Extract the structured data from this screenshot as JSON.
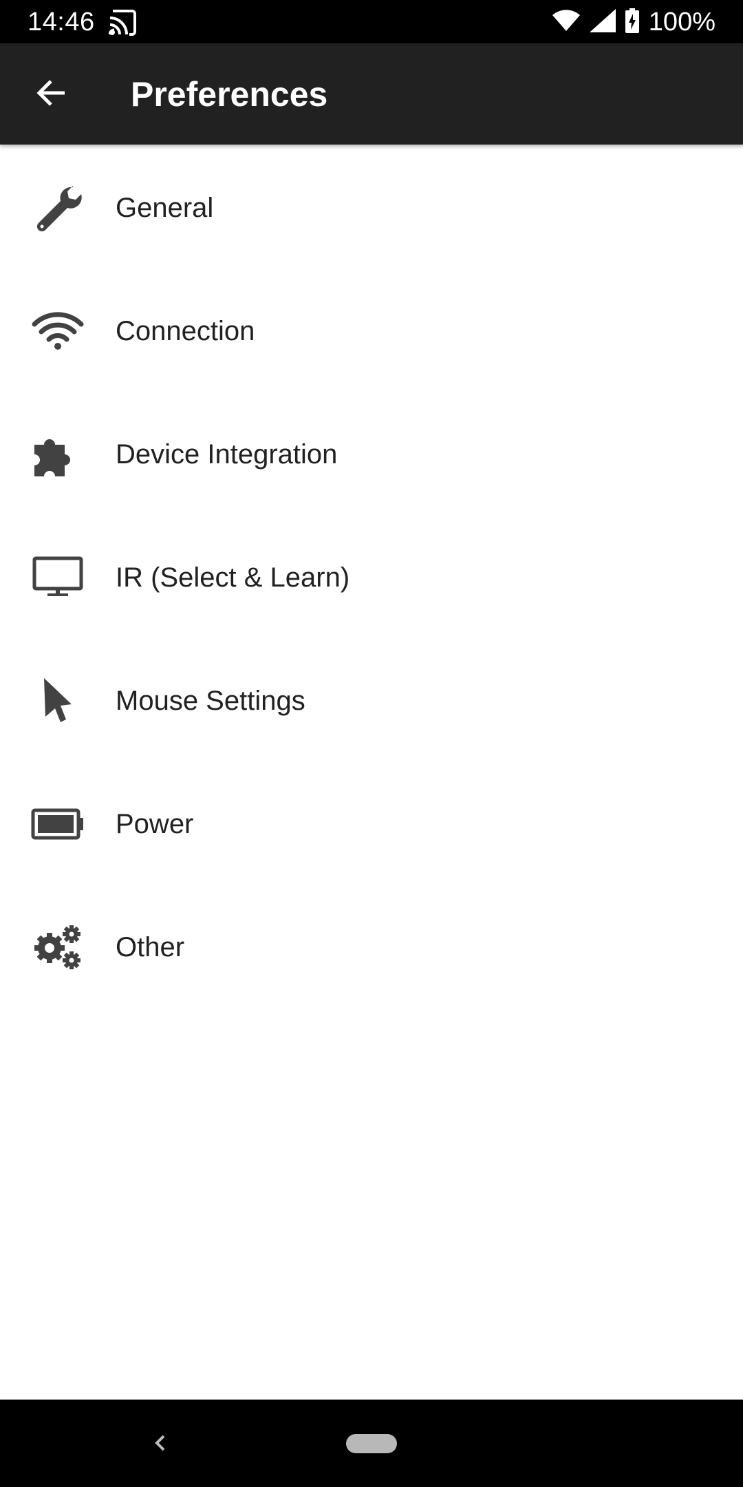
{
  "status_bar": {
    "time": "14:46",
    "battery_percent": "100%",
    "icons": [
      "cast-icon",
      "wifi-icon",
      "cellular-signal-icon",
      "battery-charging-icon"
    ]
  },
  "toolbar": {
    "title": "Preferences",
    "back_icon": "arrow-back-icon",
    "background_color": "#212121"
  },
  "preferences": {
    "items": [
      {
        "label": "General",
        "icon": "wrench-icon"
      },
      {
        "label": "Connection",
        "icon": "wifi-icon"
      },
      {
        "label": "Device Integration",
        "icon": "puzzle-piece-icon"
      },
      {
        "label": "IR (Select & Learn)",
        "icon": "monitor-icon"
      },
      {
        "label": "Mouse Settings",
        "icon": "mouse-pointer-icon"
      },
      {
        "label": "Power",
        "icon": "battery-icon"
      },
      {
        "label": "Other",
        "icon": "gears-icon"
      }
    ]
  },
  "nav_bar": {
    "icons": [
      "nav-back-icon",
      "nav-home-pill-icon"
    ]
  },
  "colors": {
    "icon": "#424242",
    "text": "#212121",
    "status_bar": "#000000",
    "background": "#ffffff"
  }
}
